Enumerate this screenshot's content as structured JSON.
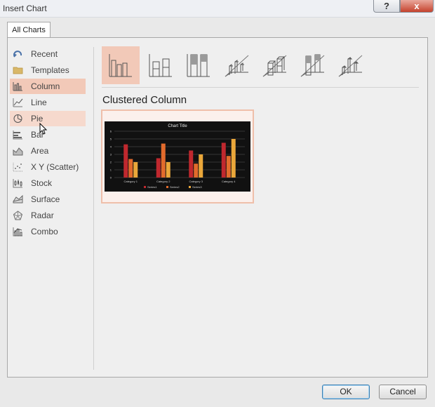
{
  "window": {
    "title": "Insert Chart",
    "help_label": "?",
    "close_label": "x"
  },
  "tabs": [
    {
      "label": "All Charts"
    }
  ],
  "sidebar": {
    "items": [
      {
        "label": "Recent",
        "icon": "recent-icon"
      },
      {
        "label": "Templates",
        "icon": "folder-icon"
      },
      {
        "label": "Column",
        "icon": "column-chart-icon",
        "selected": true
      },
      {
        "label": "Line",
        "icon": "line-chart-icon"
      },
      {
        "label": "Pie",
        "icon": "pie-chart-icon",
        "hover": true
      },
      {
        "label": "Bar",
        "icon": "bar-chart-icon"
      },
      {
        "label": "Area",
        "icon": "area-chart-icon"
      },
      {
        "label": "X Y (Scatter)",
        "icon": "scatter-chart-icon"
      },
      {
        "label": "Stock",
        "icon": "stock-chart-icon"
      },
      {
        "label": "Surface",
        "icon": "surface-chart-icon"
      },
      {
        "label": "Radar",
        "icon": "radar-chart-icon"
      },
      {
        "label": "Combo",
        "icon": "combo-chart-icon"
      }
    ]
  },
  "subtypes": {
    "selected_index": 0,
    "items": [
      "clustered-column-icon",
      "stacked-column-icon",
      "100-stacked-column-icon",
      "3d-clustered-column-icon",
      "3d-stacked-column-icon",
      "3d-100-stacked-column-icon",
      "3d-column-icon"
    ]
  },
  "selected_type_title": "Clustered Column",
  "preview": {
    "chart_data": {
      "type": "bar",
      "title": "Chart Title",
      "categories": [
        "Category 1",
        "Category 2",
        "Category 3",
        "Category 4"
      ],
      "series": [
        {
          "name": "Series1",
          "values": [
            4.3,
            2.5,
            3.5,
            4.5
          ],
          "color": "#c0282e"
        },
        {
          "name": "Series2",
          "values": [
            2.4,
            4.4,
            1.8,
            2.8
          ],
          "color": "#e26b2c"
        },
        {
          "name": "Series3",
          "values": [
            2.0,
            2.0,
            3.0,
            5.0
          ],
          "color": "#eaa73a"
        }
      ],
      "ylim": [
        0,
        6
      ],
      "yticks": [
        0,
        1,
        2,
        3,
        4,
        5,
        6
      ],
      "legend": "bottom",
      "grid": true,
      "background": "#111111"
    }
  },
  "buttons": {
    "ok": "OK",
    "cancel": "Cancel"
  },
  "colors": {
    "accent_selected": "#f2c9b8",
    "dialog_bg": "#e9e9e9"
  }
}
